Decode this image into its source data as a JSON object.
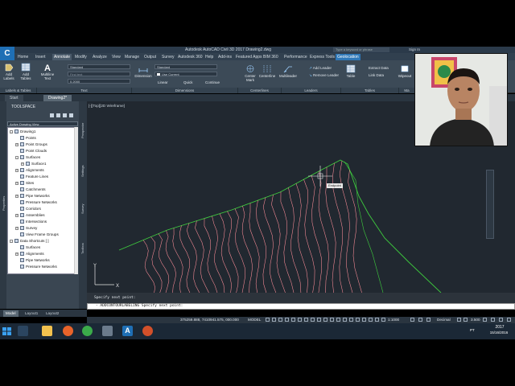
{
  "window": {
    "title": "Autodesk AutoCAD Civil 3D 2017  Drawing2.dwg",
    "search_placeholder": "Type a keyword or phrase",
    "user": "Sign In",
    "app_logo": "C3D"
  },
  "menu_tabs": [
    "Home",
    "Insert",
    "Annotate",
    "Modify",
    "Analyze",
    "View",
    "Manage",
    "Output",
    "Survey",
    "Autodesk 360",
    "Help",
    "Add-ins",
    "Featured Apps",
    "BIM 360",
    "Performance",
    "Express Tools",
    "Geolocation"
  ],
  "active_menu_tab": "Annotate",
  "ribbon": {
    "add_labels": "Add Labels",
    "add_tables": "Add Tables",
    "multiline_text": "Multiline Text",
    "text_style": "Standard",
    "find_text": "Find text",
    "text_height": "0.2000",
    "dimension": "Dimension",
    "dim_style": "Standard",
    "use_current": "Use Current",
    "linear": "Linear",
    "quick": "Quick",
    "continue": "Continue",
    "center_mark": "Center Mark",
    "centerline": "Centerline",
    "multileader": "Multileader",
    "add_leader": "Add Leader",
    "remove_leader": "Remove Leader",
    "table": "Table",
    "extract_data": "Extract Data",
    "link_data": "Link Data",
    "wipeout": "Wipeout",
    "panels": [
      "Labels & Tables",
      "Text",
      "Dimensions",
      "Centerlines",
      "Leaders",
      "Tables",
      "Ma"
    ]
  },
  "doc_tabs": [
    "Start",
    "Drawing2*"
  ],
  "toolspace": {
    "title": "TOOLSPACE",
    "view": "Active Drawing View",
    "side_tabs": [
      "Prospector",
      "Settings",
      "Survey",
      "Toolbox"
    ],
    "left_label": "Properties",
    "tree": [
      {
        "label": "Drawing1",
        "level": 0,
        "exp": "-"
      },
      {
        "label": "Points",
        "level": 1,
        "exp": ""
      },
      {
        "label": "Point Groups",
        "level": 1,
        "exp": "+"
      },
      {
        "label": "Point Clouds",
        "level": 1,
        "exp": ""
      },
      {
        "label": "Surfaces",
        "level": 1,
        "exp": "-"
      },
      {
        "label": "Surface1",
        "level": 2,
        "exp": "+"
      },
      {
        "label": "Alignments",
        "level": 1,
        "exp": "+"
      },
      {
        "label": "Feature Lines",
        "level": 1,
        "exp": ""
      },
      {
        "label": "Sites",
        "level": 1,
        "exp": "+"
      },
      {
        "label": "Catchments",
        "level": 1,
        "exp": ""
      },
      {
        "label": "Pipe Networks",
        "level": 1,
        "exp": "+"
      },
      {
        "label": "Pressure Networks",
        "level": 1,
        "exp": ""
      },
      {
        "label": "Corridors",
        "level": 1,
        "exp": ""
      },
      {
        "label": "Assemblies",
        "level": 1,
        "exp": "+"
      },
      {
        "label": "Intersections",
        "level": 1,
        "exp": ""
      },
      {
        "label": "Survey",
        "level": 1,
        "exp": "+"
      },
      {
        "label": "View Frame Groups",
        "level": 1,
        "exp": ""
      },
      {
        "label": "Data Shortcuts [ ]",
        "level": 0,
        "exp": "-"
      },
      {
        "label": "Surfaces",
        "level": 1,
        "exp": ""
      },
      {
        "label": "Alignments",
        "level": 1,
        "exp": "+"
      },
      {
        "label": "Pipe Networks",
        "level": 1,
        "exp": ""
      },
      {
        "label": "Pressure Networks",
        "level": 1,
        "exp": ""
      }
    ]
  },
  "viewport": {
    "label": "[-][Top][2D Wireframe]",
    "snap_tooltip": "Endpoint",
    "colors": {
      "background": "#212830",
      "contours": "#ff8f9a",
      "boundary": "#3ecb3e"
    }
  },
  "command": {
    "history": "Specify next point:",
    "current": "- ADDCONTOURLABELING Specify next point:"
  },
  "layout_tabs": [
    "Model",
    "Layout1",
    "Layout2"
  ],
  "status": {
    "coords": "375259.888, 7410941.575, 000.000",
    "model": "MODEL",
    "scale": "1:1000",
    "units": "Decimal",
    "value": "3.500"
  },
  "taskbar": {
    "lang": "PT",
    "time": "2017",
    "date": "15/16/2016"
  }
}
